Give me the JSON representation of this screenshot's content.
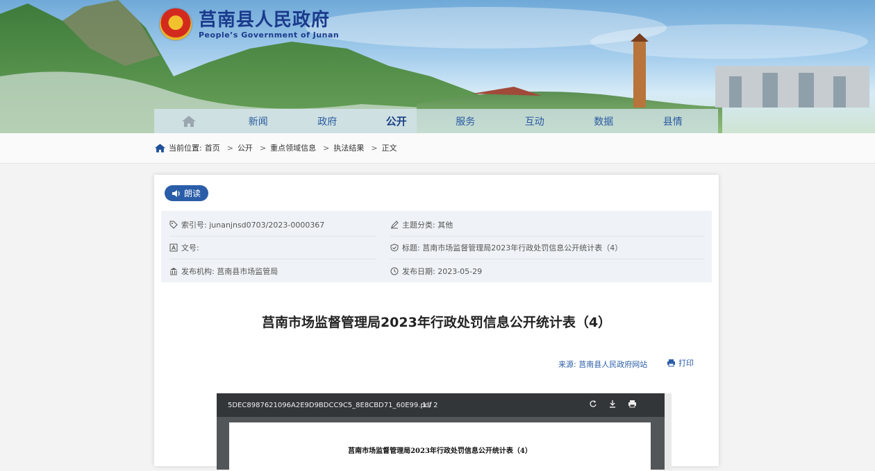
{
  "header": {
    "site_title_cn": "莒南县人民政府",
    "site_title_en": "People’s Government of Junan"
  },
  "nav": {
    "items": [
      "新闻",
      "政府",
      "公开",
      "服务",
      "互动",
      "数据",
      "县情"
    ],
    "active": "公开"
  },
  "breadcrumb": {
    "label": "当前位置:",
    "items": [
      "首页",
      "公开",
      "重点领域信息",
      "执法结果",
      "正文"
    ]
  },
  "read_aloud_label": "朗读",
  "meta": {
    "index_no": "索引号: junanjnsd0703/2023-0000367",
    "doc_no": "文号:",
    "publisher": "发布机构: 莒南县市场监管局",
    "category": "主题分类: 其他",
    "subject": "标题: 莒南市场监督管理局2023年行政处罚信息公开统计表（4）",
    "publish_date": "发布日期: 2023-05-29"
  },
  "article": {
    "title": "莒南市场监督管理局2023年行政处罚信息公开统计表（4）",
    "source": "来源: 莒南县人民政府网站",
    "print_label": "打印"
  },
  "pdf": {
    "file_name": "5DEC8987621096A2E9D9BDCC9C5_8E8CBD71_60E99.pdf",
    "page_indicator": "1 / 2",
    "page_title": "莒南市场监督管理局2023年行政处罚信息公开统计表（4）"
  },
  "colors": {
    "brand_blue": "#2a5da8",
    "nav_text": "#2a5aa0"
  }
}
